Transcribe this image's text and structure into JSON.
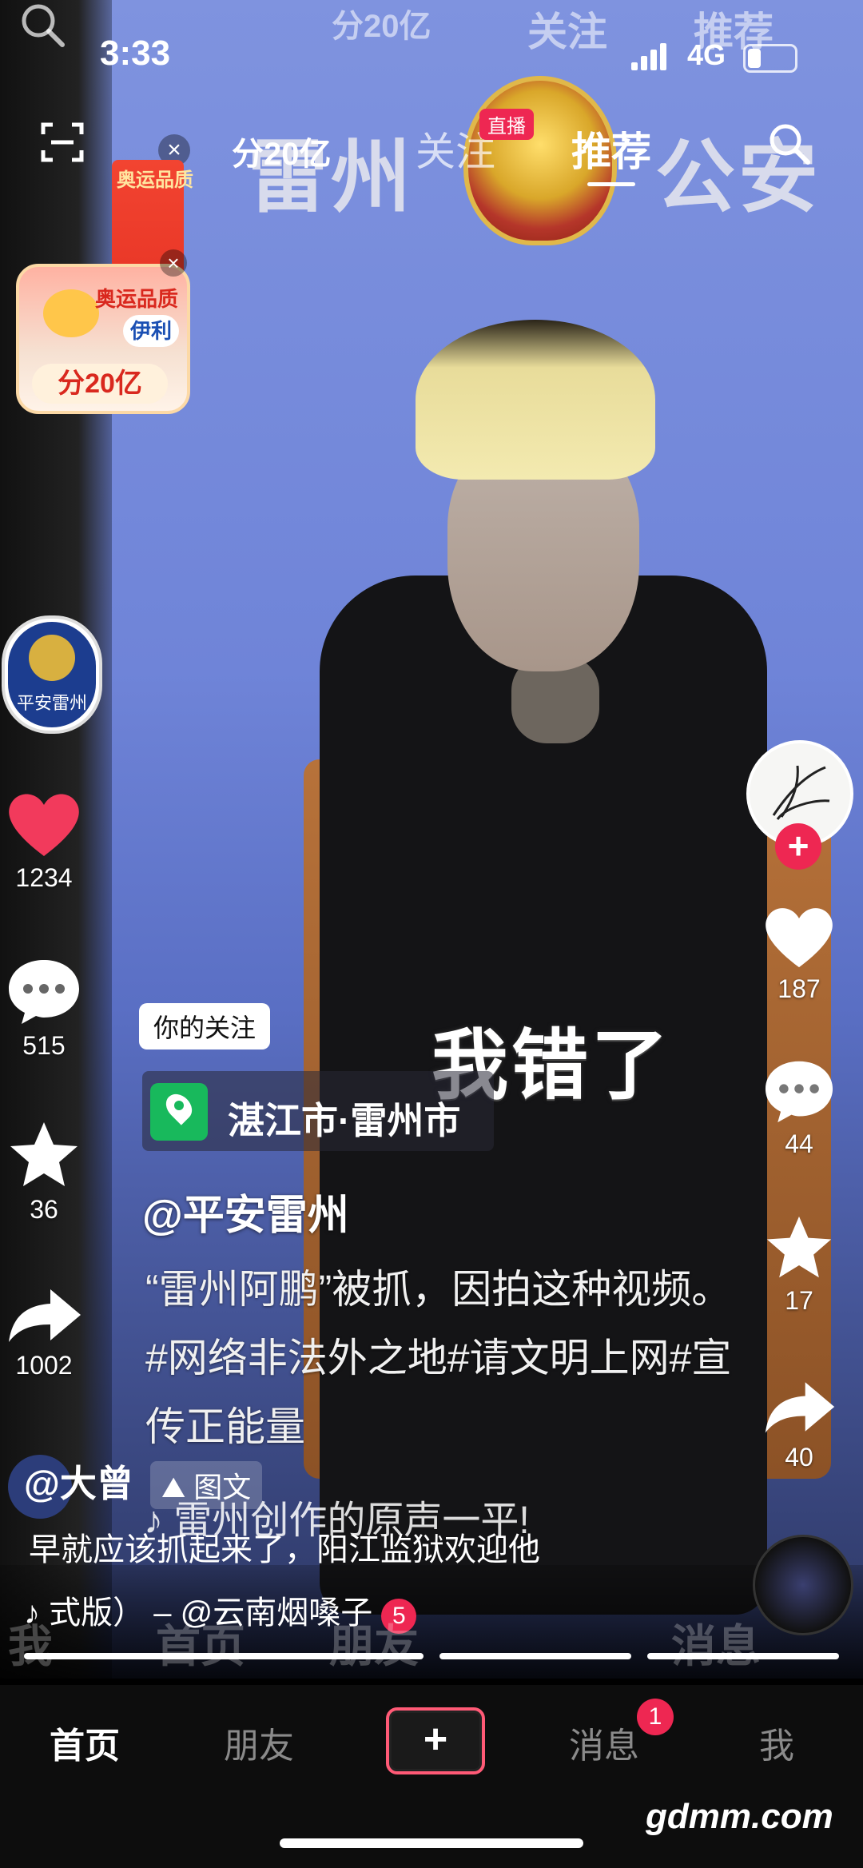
{
  "status": {
    "time": "3:33",
    "network": "4G"
  },
  "top_ghost": {
    "ad": "分20亿",
    "follow": "关注",
    "rec": "推荐"
  },
  "top_tabs": {
    "follow": "关注",
    "recommended": "推荐",
    "live_badge": "直播",
    "ad_text": "分20亿"
  },
  "video": {
    "wall_left": "雷州",
    "wall_right": "公安",
    "caption": "我错了"
  },
  "promo": {
    "brand": "伊利",
    "slogan": "奥运品质",
    "reward": "分20亿"
  },
  "left_panel": {
    "avatar_label": "平安雷州",
    "likes": "1234",
    "comments": "515",
    "favorites": "36",
    "shares": "1002"
  },
  "right_panel": {
    "likes": "187",
    "comments": "44",
    "favorites": "17",
    "shares": "40"
  },
  "post": {
    "follow_tag": "你的关注",
    "location": "湛江市·雷州市",
    "author": "@平安雷州",
    "description": "“雷州阿鹏”被抓，因拍这种视频。#网络非法外之地#请文明上网#宣传正能量",
    "music": "雷州创作的原声一平!"
  },
  "comment": {
    "user": "@大曾",
    "badge": "图文",
    "text": "早就应该抓起来了，阳江监狱欢迎他"
  },
  "music_bar": {
    "text": "式版） – @云南烟嗓子",
    "badge": "5"
  },
  "ghost_nav": {
    "me": "我",
    "home": "首页",
    "friends": "朋友",
    "messages": "消息"
  },
  "bottom_nav": {
    "home": "首页",
    "friends": "朋友",
    "plus": "+",
    "messages": "消息",
    "messages_badge": "1",
    "me": "我"
  },
  "watermark": "gdmm.com",
  "colors": {
    "accent_red": "#ee2752",
    "location_green": "#18b95c",
    "nav_bg": "#0d0d0d"
  }
}
